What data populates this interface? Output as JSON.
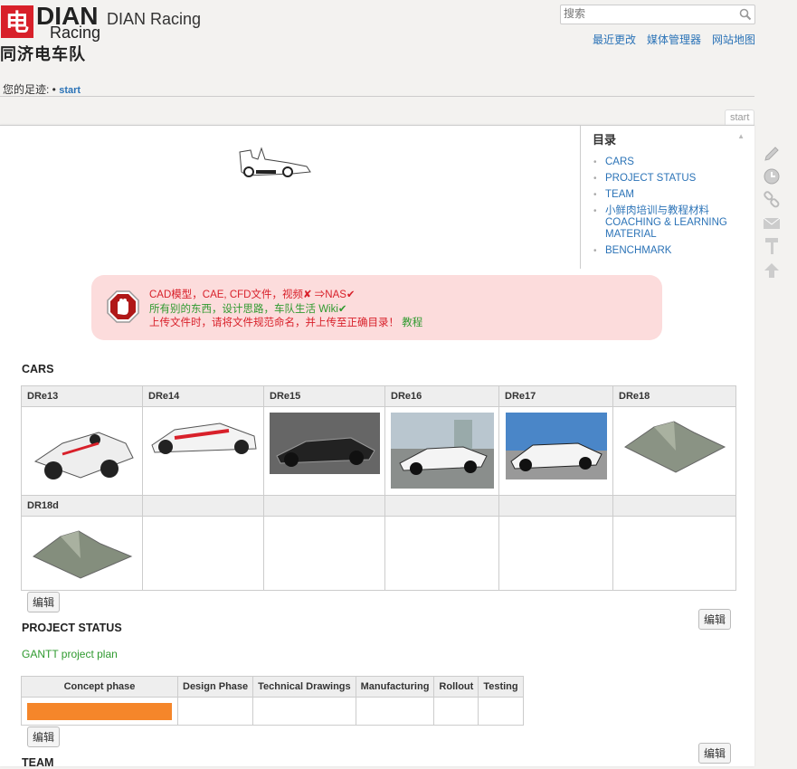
{
  "header": {
    "logo_top": "DIAN",
    "logo_mid": "Racing",
    "logo_cn": "同济电车队",
    "site_title": "DIAN Racing",
    "search_placeholder": "搜索",
    "links": [
      "最近更改",
      "媒体管理器",
      "网站地图"
    ]
  },
  "breadcrumb": {
    "label": "您的足迹: •",
    "current": "start"
  },
  "page_tab": "start",
  "toc": {
    "title": "目录",
    "items": [
      "CARS",
      "PROJECT STATUS",
      "TEAM",
      "小鲜肉培训与教程材料 COACHING & LEARNING MATERIAL",
      "BENCHMARK"
    ]
  },
  "notice": {
    "line1": "CAD模型，CAE, CFD文件，视频✘ ⇒NAS✔",
    "line2": "所有别的东西，设计思路，车队生活 Wiki✔",
    "line3_text": "上传文件时，请将文件规范命名，并上传至正确目录！",
    "line3_link": "教程"
  },
  "sections": {
    "cars": "CARS",
    "project_status": "PROJECT STATUS",
    "team": "TEAM"
  },
  "cars": {
    "row1": [
      "DRe13",
      "DRe14",
      "DRe15",
      "DRe16",
      "DRe17",
      "DRe18"
    ],
    "row2": [
      "DR18d",
      "",
      "",
      "",
      "",
      ""
    ]
  },
  "edit_label": "编辑",
  "gantt_link": "GANTT project plan",
  "status_table": {
    "headers": [
      "Concept phase",
      "Design Phase",
      "Technical Drawings",
      "Manufacturing",
      "Rollout",
      "Testing"
    ],
    "progress_color": "#f5862a"
  },
  "colors": {
    "link": "#2b73b7",
    "notice_bg": "#fcdcdc",
    "red": "#d8202a",
    "green": "#2f9a2f"
  }
}
